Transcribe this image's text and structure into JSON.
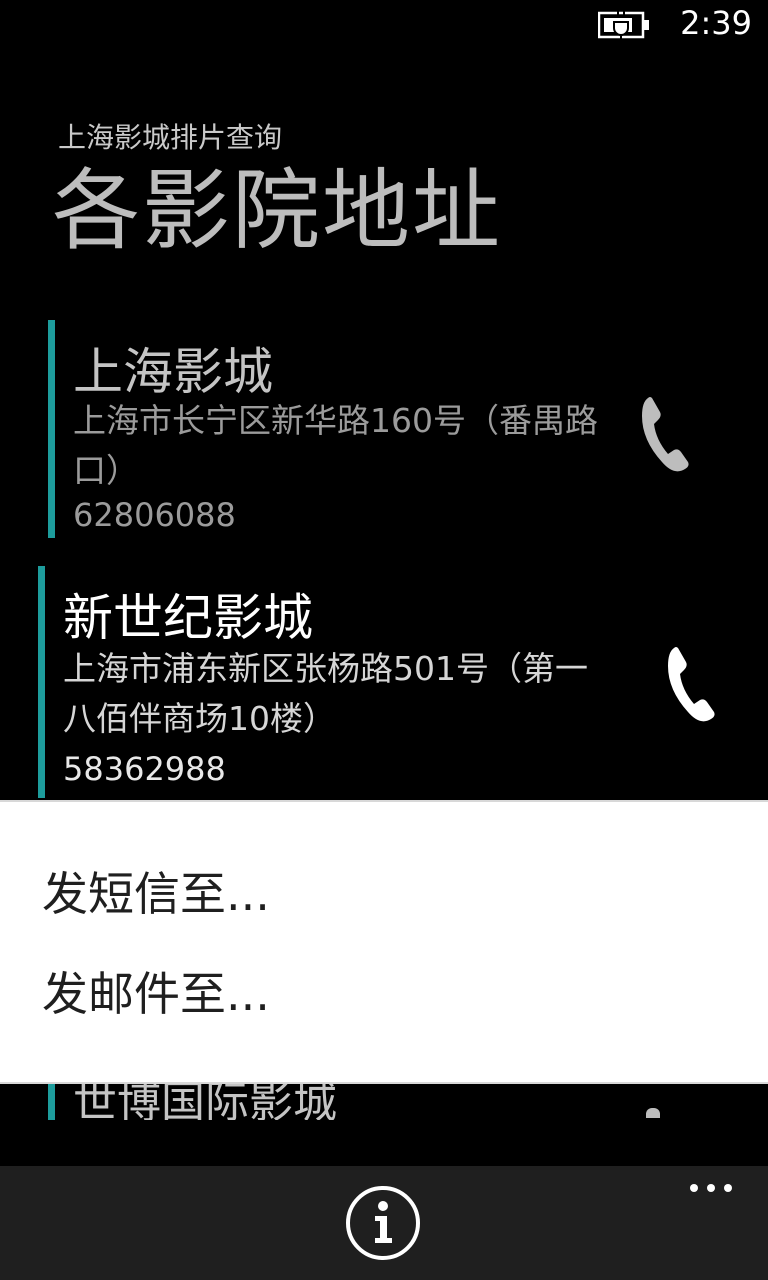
{
  "status": {
    "time": "2:39",
    "battery_icon": "battery-charging-icon"
  },
  "header": {
    "app_title": "上海影城排片查询",
    "page_title": "各影院地址"
  },
  "cinemas": [
    {
      "name": "上海影城",
      "address": "上海市长宁区新华路160号（番禺路口）",
      "phone": "62806088",
      "call_icon": "phone-icon"
    },
    {
      "name": "新世纪影城",
      "address": "上海市浦东新区张杨路501号（第一八佰伴商场10楼）",
      "phone": "58362988",
      "call_icon": "phone-icon"
    },
    {
      "name": "世博国际影城",
      "call_icon": "phone-icon"
    }
  ],
  "context_menu": {
    "items": [
      "发短信至...",
      "发邮件至..."
    ]
  },
  "app_bar": {
    "info_icon": "info-icon",
    "more_icon": "more-dots-icon"
  },
  "colors": {
    "accent": "#1d9c9c",
    "background": "#000000",
    "menu_background": "#ffffff",
    "app_bar": "#1f1f1f"
  }
}
